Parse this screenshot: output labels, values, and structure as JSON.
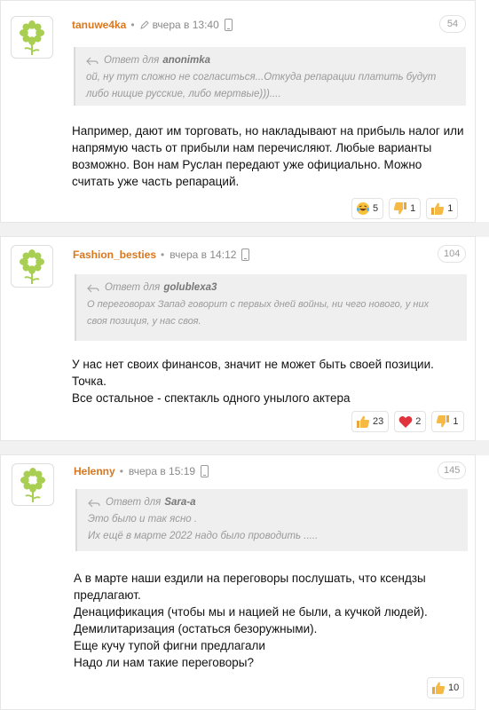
{
  "comments": [
    {
      "username": "tanuwe4ka",
      "time": "вчера в 13:40",
      "edited": true,
      "number": "54",
      "reply_label": "Ответ для",
      "reply_to": "anonimka",
      "quote_lines": [
        "ой, ну тут сложно не согласиться...Откуда репарации платить будут",
        "либо нищие русские, либо мертвые)))...."
      ],
      "body_lines": [
        "Например, дают им торговать, но накладывают на прибыль налог или",
        "напрямую часть от прибыли нам перечисляют. Любые варианты",
        "возможно. Вон нам Руслан передают уже официально. Можно",
        "считать уже часть репараций."
      ],
      "reactions": [
        {
          "icon": "laugh-emoji-icon",
          "count": "5"
        },
        {
          "icon": "thumbs-down-icon",
          "count": "1"
        },
        {
          "icon": "thumbs-up-icon",
          "count": "1"
        }
      ]
    },
    {
      "username": "Fashion_besties",
      "time": "вчера в 14:12",
      "edited": false,
      "number": "104",
      "reply_label": "Ответ для",
      "reply_to": "golublexa3",
      "quote_lines": [
        "О переговорах Запад говорит с первых дней войны, ни чего нового, у них",
        "своя позиция, у нас своя."
      ],
      "body_lines": [
        "У нас нет своих финансов, значит не может быть своей позиции.",
        "Точка.",
        "Все остальное - спектакль одного унылого актера"
      ],
      "reactions": [
        {
          "icon": "thumbs-up-icon",
          "count": "23"
        },
        {
          "icon": "heart-icon",
          "count": "2"
        },
        {
          "icon": "thumbs-down-icon",
          "count": "1"
        }
      ]
    },
    {
      "username": "Helenny",
      "time": "вчера в 15:19",
      "edited": false,
      "number": "145",
      "reply_label": "Ответ для",
      "reply_to": "Sara-a",
      "quote_lines": [
        "Это было и так ясно .",
        "Их ещё в марте 2022 надо было проводить ....."
      ],
      "body_lines": [
        "А в марте наши ездили на переговоры послушать, что ксендзы",
        "предлагают.",
        "Денацификация (чтобы мы и нацией не были, а кучкой людей).",
        "Демилитаризация (остаться безоружными).",
        "Еще кучу тупой фигни предлагали",
        "Надо ли нам такие переговоры?"
      ],
      "reactions": [
        {
          "icon": "thumbs-up-icon",
          "count": "10"
        }
      ]
    }
  ],
  "colors": {
    "username": "#d9771f",
    "muted": "#8a8a8a",
    "quote_bg": "#efefef",
    "avatar_flower": "#a8cf52"
  }
}
